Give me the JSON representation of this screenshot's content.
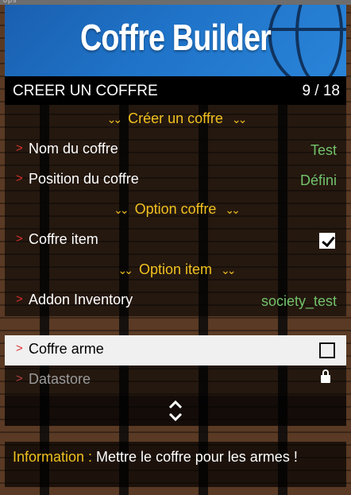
{
  "overlay": {
    "faint_text": "ops"
  },
  "banner": {
    "title": "Coffre Builder"
  },
  "header": {
    "title": "CREER UN COFFRE",
    "counter": "9 / 18"
  },
  "menu": {
    "sep_create": "Créer un coffre",
    "name_label": "Nom du coffre",
    "name_value": "Test",
    "position_label": "Position du coffre",
    "position_value": "Défini",
    "sep_option_coffre": "Option coffre",
    "item_label": "Coffre item",
    "item_checked": true,
    "sep_option_item": "Option item",
    "addon_label": "Addon Inventory",
    "addon_value": "society_test",
    "arme_label": "Coffre arme",
    "arme_checked": false,
    "datastore_label": "Datastore",
    "arrow_glyph": ">",
    "chevrons": "⌄⌄"
  },
  "info": {
    "key": "Information :",
    "text": " Mettre le coffre pour les armes !"
  },
  "colors": {
    "accent": "#f0c020",
    "value_green": "#72c26b",
    "arrow_red": "#e03030",
    "banner_blue": "#1f73c8"
  },
  "icons": [
    "chevron-down-icon",
    "checkmark-icon",
    "lock-icon",
    "scroll-up-down-icon"
  ]
}
